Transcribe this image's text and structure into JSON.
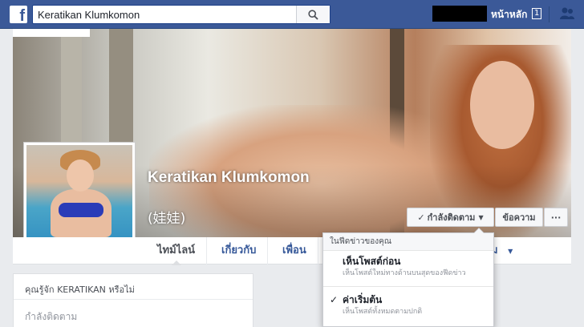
{
  "topbar": {
    "logo_letter": "f",
    "search_value": "Keratikan Klumkomon",
    "home_label": "หน้าหลัก",
    "home_badge": "1"
  },
  "profile": {
    "name": "Keratikan Klumkomon",
    "alt_name": "(娃娃)"
  },
  "actions": {
    "follow_label": "กำลังติดตาม",
    "message_label": "ข้อความ",
    "more_label": "···"
  },
  "nav": {
    "tabs": [
      {
        "label": "ไทม์ไลน์"
      },
      {
        "label": "เกี่ยวกับ"
      },
      {
        "label": "เพื่อน"
      }
    ],
    "extra_label": "ม"
  },
  "panel": {
    "title": "คุณรู้จัก KERATIKAN หรือไม่",
    "following_label": "กำลังติดตาม"
  },
  "dropdown": {
    "header": "ในฟีดข่าวของคุณ",
    "items": [
      {
        "title": "เห็นโพสต์ก่อน",
        "desc": "เห็นโพสต์ใหม่ทางด้านบนสุดของฟีดข่าว"
      },
      {
        "title": "ค่าเริ่มต้น",
        "desc": "เห็นโพสต์ทั้งหมดตามปกติ"
      }
    ]
  },
  "colors": {
    "brand": "#3b5998",
    "link": "#365899"
  }
}
